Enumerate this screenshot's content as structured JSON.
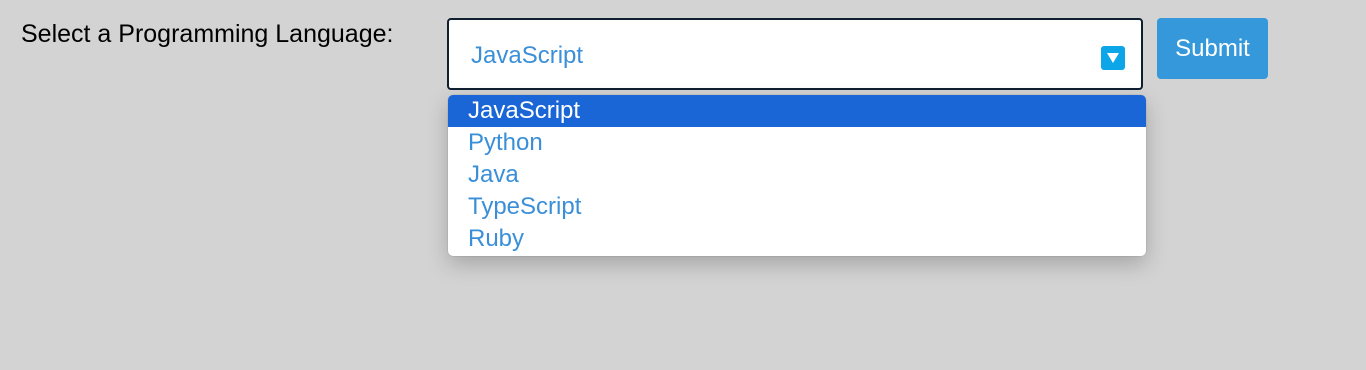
{
  "form": {
    "label": "Select a Programming Language:",
    "selected_value": "JavaScript",
    "submit_label": "Submit"
  },
  "dropdown": {
    "icon": "chevron-down-icon",
    "options": [
      {
        "label": "JavaScript",
        "selected": true
      },
      {
        "label": "Python",
        "selected": false
      },
      {
        "label": "Java",
        "selected": false
      },
      {
        "label": "TypeScript",
        "selected": false
      },
      {
        "label": "Ruby",
        "selected": false
      }
    ]
  },
  "colors": {
    "background": "#d3d3d3",
    "accent": "#3498db",
    "option_text": "#3a8fd8",
    "highlight": "#1a66d6",
    "arrow_icon": "#0ba5e8"
  }
}
